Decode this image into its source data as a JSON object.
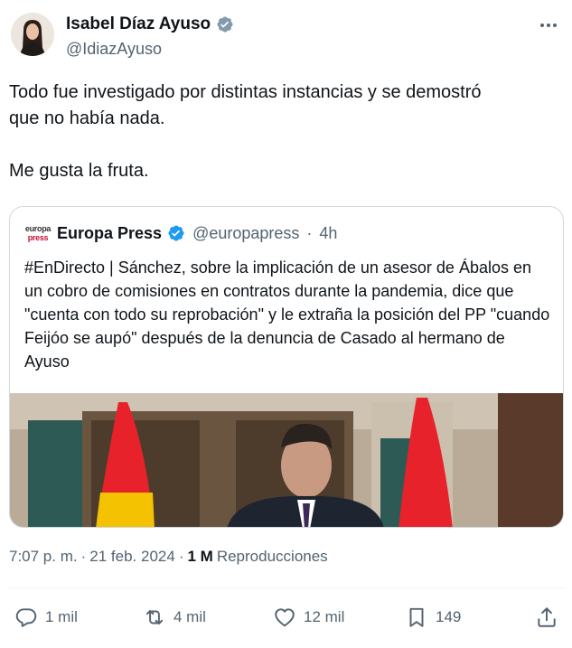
{
  "author": {
    "name": "Isabel Díaz Ayuso",
    "handle": "@IdiazAyuso",
    "verified_color": "#829aab"
  },
  "tweet": {
    "text": "Todo fue investigado por distintas instancias y se demostró\nque no había nada.\n\nMe gusta la fruta."
  },
  "quoted": {
    "logo_line1": "europa",
    "logo_line2": "press",
    "name": "Europa Press",
    "handle": "@europapress",
    "separator": "·",
    "time": "4h",
    "verified_color": "#1d9bf0",
    "text": "#EnDirecto | Sánchez, sobre la implicación de un asesor de Ábalos en un cobro de comisiones en contratos durante la pandemia, dice que \"cuenta con todo su reprobación\" y le extraña la posición del PP \"cuando Feijóo se aupó\" después de la denuncia de Casado al hermano de Ayuso"
  },
  "meta": {
    "time": "7:07 p. m.",
    "sep1": "·",
    "date": "21 feb. 2024",
    "sep2": "·",
    "views_count": "1 M",
    "views_label": "Reproducciones"
  },
  "actions": {
    "replies": "1 mil",
    "reposts": "4 mil",
    "likes": "12 mil",
    "bookmarks": "149"
  },
  "colors": {
    "text": "#0f1419",
    "secondary": "#536471",
    "border": "#cfd9de"
  },
  "icons": [
    "verified-icon",
    "more-icon",
    "reply-icon",
    "repost-icon",
    "like-icon",
    "bookmark-icon",
    "share-icon"
  ]
}
